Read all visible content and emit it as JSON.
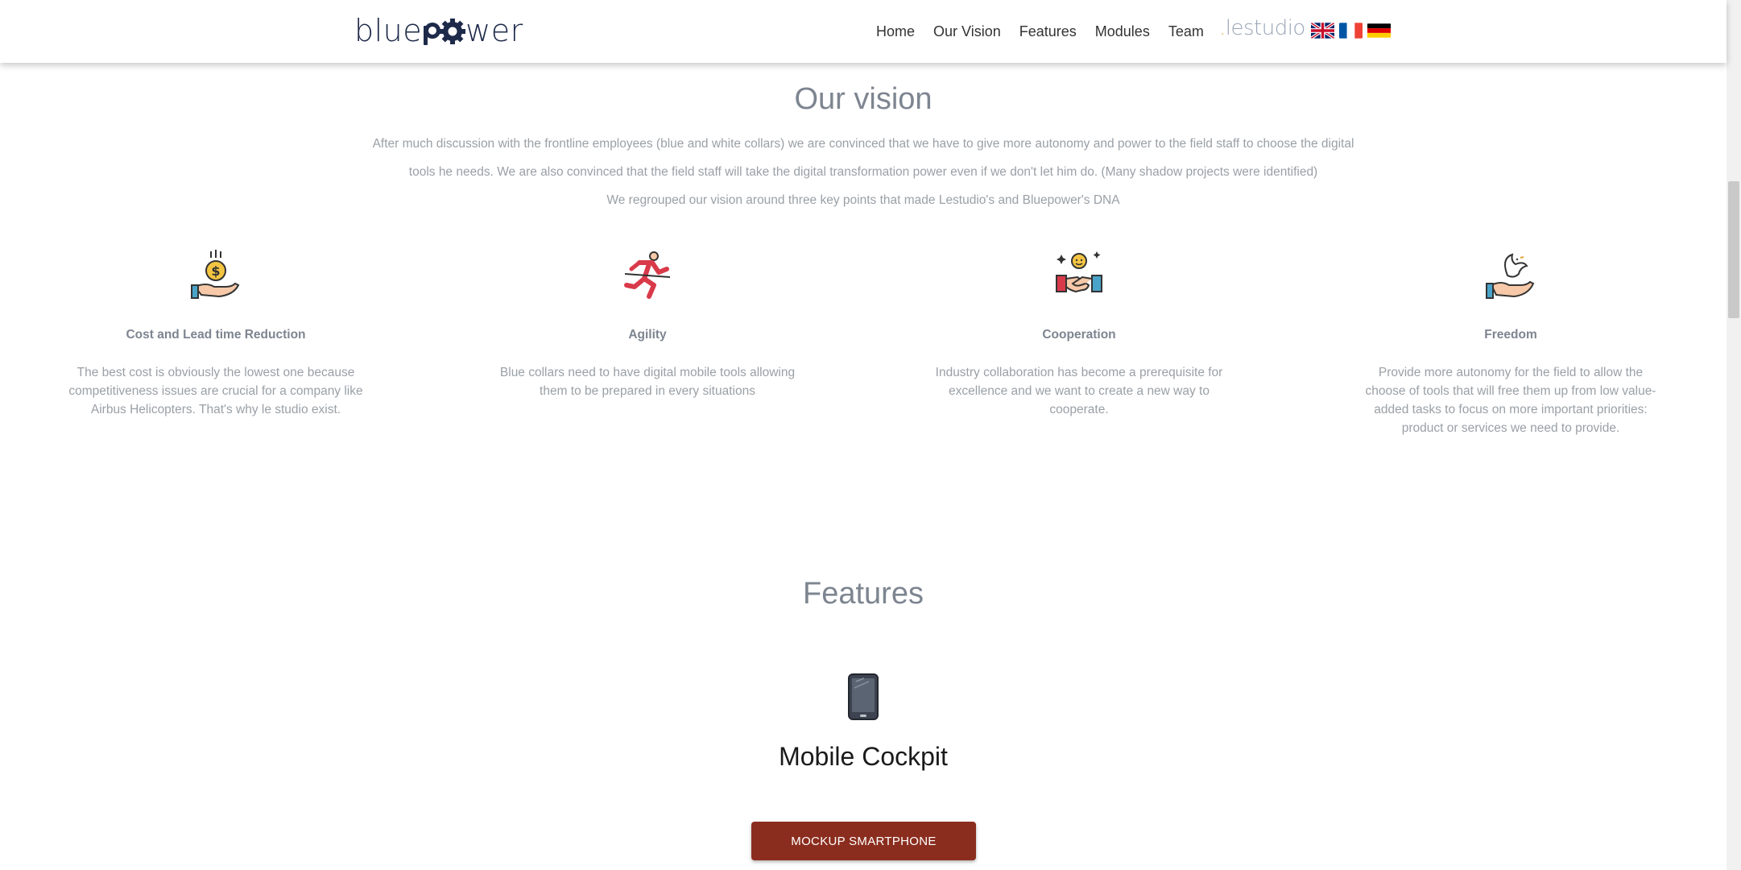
{
  "header": {
    "logo_left": "blue",
    "logo_right": "wer",
    "nav": [
      "Home",
      "Our Vision",
      "Features",
      "Modules",
      "Team"
    ],
    "partner_dot": ".",
    "partner_name": "lestudio",
    "flags": [
      "uk-flag-icon",
      "france-flag-icon",
      "germany-flag-icon"
    ]
  },
  "vision": {
    "title": "Our vision",
    "paragraphs": [
      "After much discussion with the frontline employees (blue and white collars) we are convinced that we have to give more autonomy and power to the field staff to choose the digital",
      "tools he needs. We are also convinced that the field staff will take the digital transformation power even if we don't let him do. (Many shadow projects were identified)",
      "We regrouped our vision around three key points that made Lestudio's and Bluepower's DNA"
    ],
    "pillars": [
      {
        "icon": "hand-coin-icon",
        "title": "Cost and Lead time Reduction",
        "text": "The best cost is obviously the lowest one because competitiveness issues are crucial for a company like Airbus Helicopters. That's why le studio exist."
      },
      {
        "icon": "runner-icon",
        "title": "Agility",
        "text": "Blue collars need to have digital mobile tools allowing them to be prepared in every situations"
      },
      {
        "icon": "handshake-icon",
        "title": "Cooperation",
        "text": "Industry collaboration has become a prerequisite for excellence and we want to create a new way to cooperate."
      },
      {
        "icon": "dove-hand-icon",
        "title": "Freedom",
        "text": "Provide more autonomy for the field to allow the choose of tools that will free them up from low value-added tasks to focus on more important priorities: product or services we need to provide."
      }
    ]
  },
  "features": {
    "title": "Features",
    "feature_name": "Mobile Cockpit",
    "feature_icon": "smartphone-icon",
    "button": "MOCKUP SMARTPHONE"
  },
  "colors": {
    "accent": "#8b2d1e",
    "logo": "#1e2a4a",
    "text": "#7d8590"
  }
}
